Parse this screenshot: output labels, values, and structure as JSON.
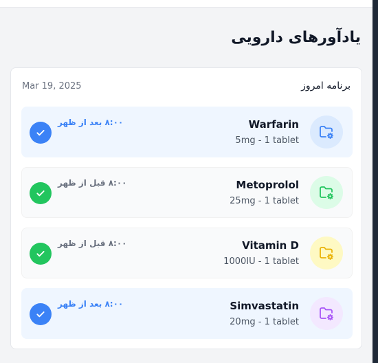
{
  "page": {
    "title": "یادآورهای دارویی"
  },
  "schedule": {
    "heading": "برنامه امروز",
    "date": "Mar 19, 2025"
  },
  "medications": [
    {
      "name": "Warfarin",
      "dose": "5mg - 1 tablet",
      "time": "۸:۰۰ بعد از ظهر",
      "icon": "folder-settings-icon",
      "icon_color": "#3b82f6",
      "icon_bg": "#dbeafe",
      "row_style": "blue",
      "time_color": "#3b82f6",
      "check_color": "#3b82f6",
      "taken": true
    },
    {
      "name": "Metoprolol",
      "dose": "25mg - 1 tablet",
      "time": "۸:۰۰ قبل از ظهر",
      "icon": "folder-settings-icon",
      "icon_color": "#22c55e",
      "icon_bg": "#dcfce7",
      "row_style": "gray",
      "time_color": "#6b7280",
      "check_color": "#22c55e",
      "taken": true
    },
    {
      "name": "Vitamin D",
      "dose": "1000IU - 1 tablet",
      "time": "۸:۰۰ قبل از ظهر",
      "icon": "folder-settings-icon",
      "icon_color": "#eab308",
      "icon_bg": "#fef9c3",
      "row_style": "gray",
      "time_color": "#6b7280",
      "check_color": "#22c55e",
      "taken": true
    },
    {
      "name": "Simvastatin",
      "dose": "20mg - 1 tablet",
      "time": "۸:۰۰ بعد از ظهر",
      "icon": "folder-settings-icon",
      "icon_color": "#a855f7",
      "icon_bg": "#f3e8ff",
      "row_style": "blue",
      "time_color": "#3b82f6",
      "check_color": "#3b82f6",
      "taken": true
    }
  ]
}
